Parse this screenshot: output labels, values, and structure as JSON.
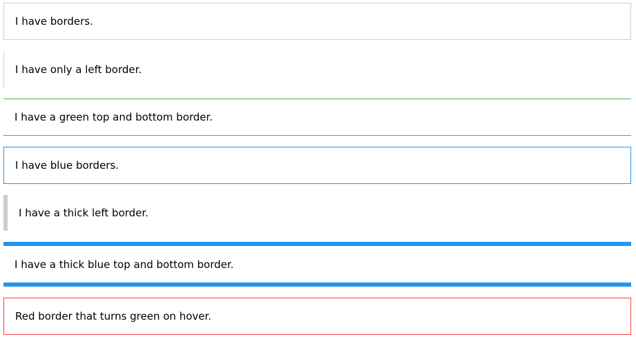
{
  "boxes": [
    {
      "text": "I have borders."
    },
    {
      "text": "I have only a left border."
    },
    {
      "text": "I have a green top and bottom border."
    },
    {
      "text": "I have blue borders."
    },
    {
      "text": "I have a thick left border."
    },
    {
      "text": "I have a thick blue top and bottom border."
    },
    {
      "text": "Red border that turns green on hover."
    }
  ],
  "colors": {
    "gray_border": "#cccccc",
    "green_border": "#4caf50",
    "blue_border": "#2196f3",
    "red_border": "#f44336",
    "hover_border": "#4caf50"
  }
}
